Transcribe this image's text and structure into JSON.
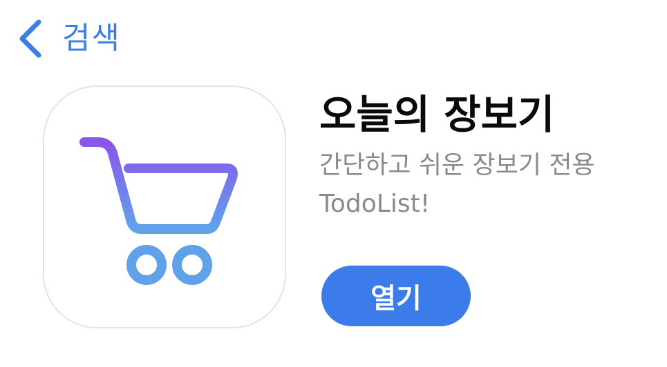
{
  "nav": {
    "back_label": "검색"
  },
  "app": {
    "title": "오늘의 장보기",
    "subtitle": "간단하고 쉬운 장보기 전용 TodoList!",
    "icon": "shopping-cart-icon",
    "open_button_label": "열기"
  },
  "colors": {
    "accent": "#3b7bea",
    "back_text": "#3a7ee6",
    "subtitle_text": "#8a8a8e",
    "cart_gradient_top": "#8b55ea",
    "cart_gradient_bottom": "#5fa2ea"
  }
}
